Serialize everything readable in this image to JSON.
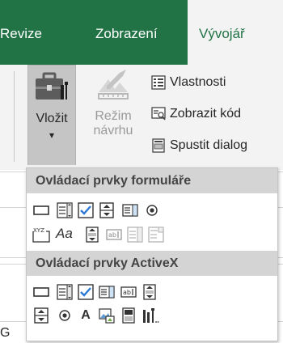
{
  "tabs": [
    {
      "label": "Revize",
      "active": false
    },
    {
      "label": "Zobrazení",
      "active": false
    },
    {
      "label": "Vývojář",
      "active": true
    }
  ],
  "ribbon": {
    "insert_label": "Vložit",
    "insert_arrow": "▾",
    "design_mode_line1": "Režim",
    "design_mode_line2": "návrhu",
    "properties_label": "Vlastnosti",
    "view_code_label": "Zobrazit kód",
    "run_dialog_label": "Spustit dialog"
  },
  "dropdown": {
    "form_controls_header": "Ovládací prvky formuláře",
    "activex_header": "Ovládací prvky ActiveX",
    "label_glyph": "Aa",
    "activex_label_glyph": "A",
    "group_box_glyph": "XYZ"
  },
  "sheet": {
    "column_letter": "G"
  },
  "colors": {
    "tab_bar": "#217346",
    "ribbon_bg": "#f3f3f3",
    "header_bg": "#d4d4d4",
    "checkbox_blue": "#2b78d6"
  }
}
